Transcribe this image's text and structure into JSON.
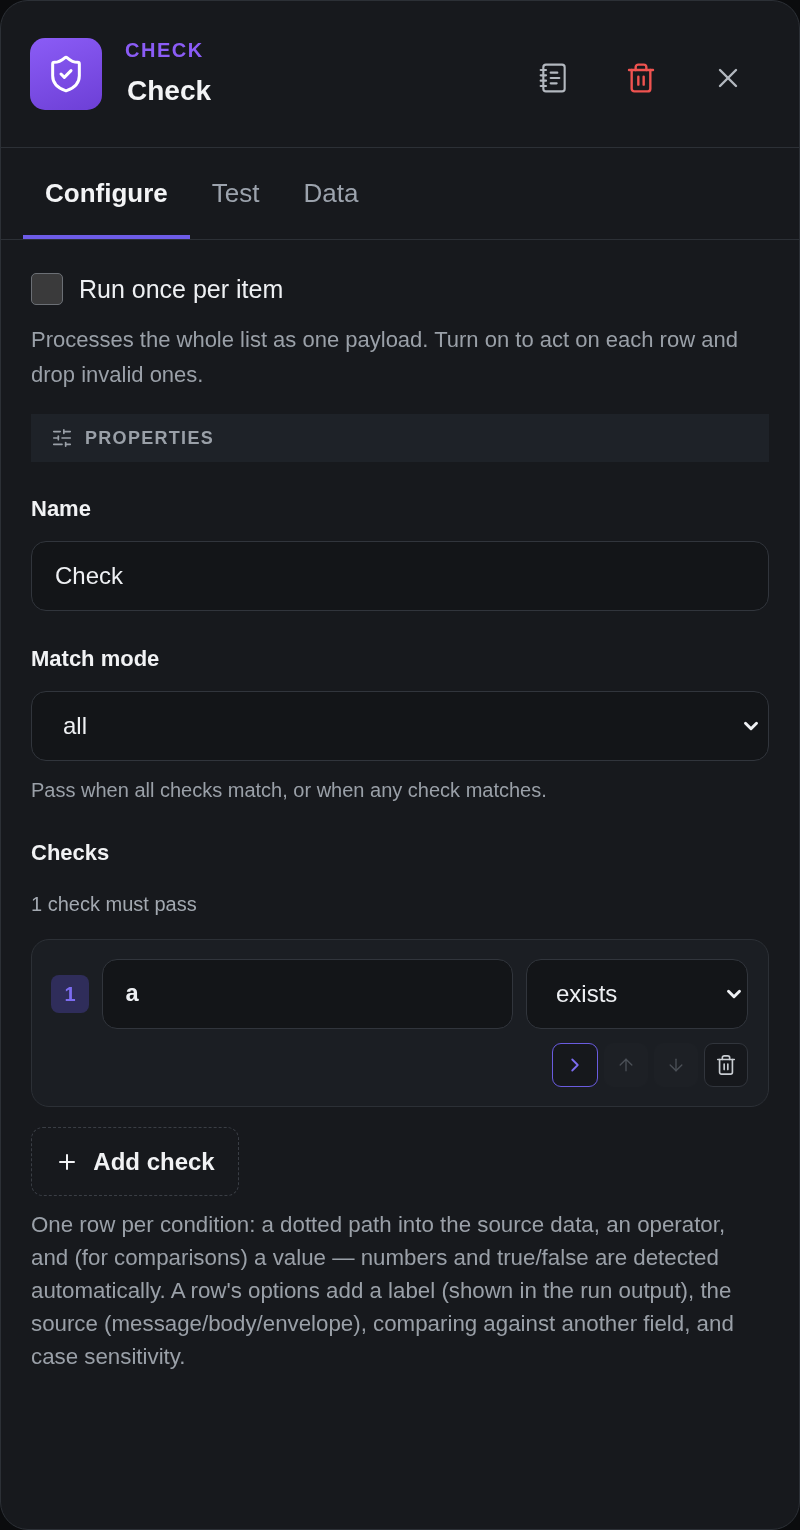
{
  "header": {
    "kind_label": "CHECK",
    "title": "Check"
  },
  "tabs": [
    {
      "label": "Configure",
      "selected": true
    },
    {
      "label": "Test",
      "selected": false
    },
    {
      "label": "Data",
      "selected": false
    }
  ],
  "run_once": {
    "label": "Run once per item",
    "checked": false,
    "help": "Processes the whole list as one payload. Turn on to act on each row and drop invalid ones."
  },
  "section": {
    "title": "PROPERTIES"
  },
  "fields": [
    {
      "kind": "text",
      "label": "Name",
      "value": "Check"
    },
    {
      "kind": "select",
      "label": "Match mode",
      "value": "all",
      "help": "Pass when all checks match, or when any check matches."
    }
  ],
  "checks": {
    "label": "Checks",
    "summary": "1 check must pass",
    "rows": [
      {
        "number": "1",
        "path": "a",
        "operator": "exists",
        "actions": [
          {
            "kind": "expand",
            "disabled": false
          },
          {
            "kind": "move-up",
            "disabled": true
          },
          {
            "kind": "move-down",
            "disabled": true
          },
          {
            "kind": "delete",
            "disabled": false
          }
        ]
      }
    ],
    "add_label": "Add check",
    "help": "One row per condition: a dotted path into the source data, an operator, and (for comparisons) a value — numbers and true/false are detected automatically. A row's options add a label (shown in the run output), the source (message/body/envelope), comparing against another field, and case sensitivity."
  }
}
